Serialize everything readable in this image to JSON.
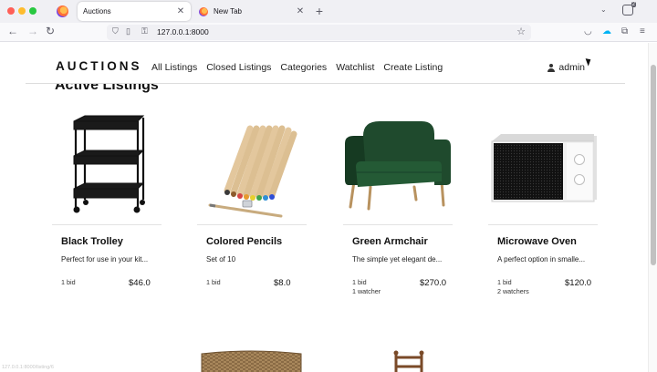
{
  "browser": {
    "tabs": [
      {
        "title": "Auctions",
        "active": true
      },
      {
        "title": "New Tab",
        "active": false
      }
    ],
    "url": "127.0.0.1:8000",
    "account_badge": "2"
  },
  "site": {
    "brand": "AUCTIONS",
    "nav": [
      "All Listings",
      "Closed Listings",
      "Categories",
      "Watchlist",
      "Create Listing"
    ],
    "user": "admin"
  },
  "page": {
    "heading": "Active Listings",
    "listings": [
      {
        "title": "Black Trolley",
        "description": "Perfect for use in your kit...",
        "bids": "1 bid",
        "watchers": "",
        "price": "$46.0",
        "image": "trolley-image"
      },
      {
        "title": "Colored Pencils",
        "description": "Set of 10",
        "bids": "1 bid",
        "watchers": "",
        "price": "$8.0",
        "image": "pencils-image"
      },
      {
        "title": "Green Armchair",
        "description": "The simple yet elegant de...",
        "bids": "1 bid",
        "watchers": "1 watcher",
        "price": "$270.0",
        "image": "armchair-image"
      },
      {
        "title": "Microwave Oven",
        "description": "A perfect option in smalle...",
        "bids": "1 bid",
        "watchers": "2 watchers",
        "price": "$120.0",
        "image": "microwave-image"
      }
    ]
  },
  "status_text": "127.0.0.1:8000/listing/6"
}
